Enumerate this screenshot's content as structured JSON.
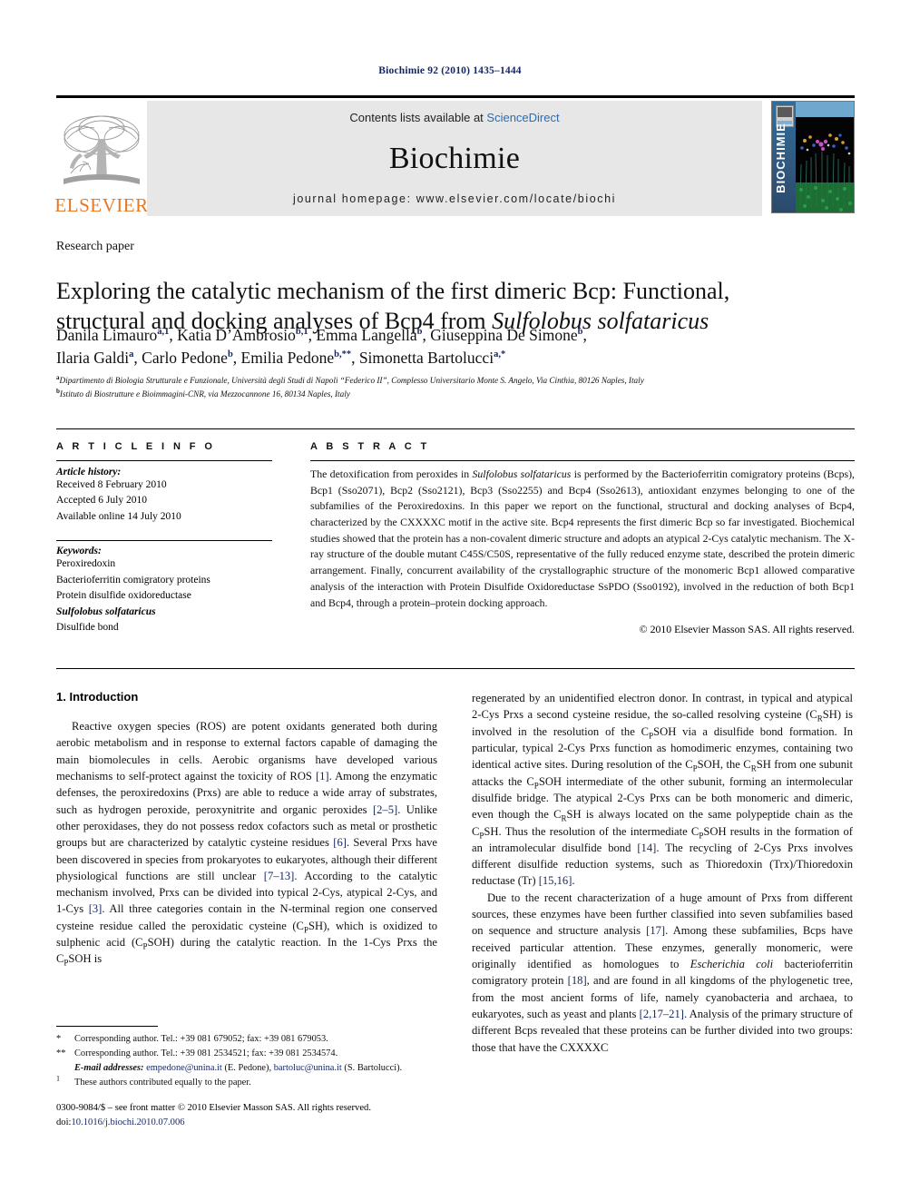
{
  "running_head": "Biochimie 92 (2010) 1435–1444",
  "masthead": {
    "contents_prefix": "Contents lists available at ",
    "contents_link": "ScienceDirect",
    "journal_title": "Biochimie",
    "homepage": "journal homepage: www.elsevier.com/locate/biochi",
    "publisher_logo_text": "ELSEVIER",
    "cover_title": "BIOCHIMIE"
  },
  "article_type": "Research paper",
  "title": {
    "line1": "Exploring the catalytic mechanism of the first dimeric Bcp: Functional,",
    "line2_pre": "structural and docking analyses of Bcp4 from ",
    "line2_italic": "Sulfolobus solfataricus"
  },
  "authors": [
    {
      "name": "Danila Limauro",
      "sup": "a,1",
      "sep": ", "
    },
    {
      "name": "Katia D’Ambrosio",
      "sup": "b,1",
      "sep": ", "
    },
    {
      "name": "Emma Langella",
      "sup": "b",
      "sep": ", "
    },
    {
      "name": "Giuseppina De Simone",
      "sup": "b",
      "sep": ","
    },
    {
      "name": "Ilaria Galdi",
      "sup": "a",
      "sep": ", "
    },
    {
      "name": "Carlo Pedone",
      "sup": "b",
      "sep": ", "
    },
    {
      "name": "Emilia Pedone",
      "sup": "b,**",
      "sep": ", "
    },
    {
      "name": "Simonetta Bartolucci",
      "sup": "a,*",
      "sep": ""
    }
  ],
  "affiliations": [
    {
      "mark": "a",
      "text": "Dipartimento di Biologia Strutturale e Funzionale, Università degli Studi di Napoli “Federico II”, Complesso Universitario Monte S. Angelo, Via Cinthia, 80126 Naples, Italy"
    },
    {
      "mark": "b",
      "text": "Istituto di Biostrutture e Bioimmagini-CNR, via Mezzocannone 16, 80134 Naples, Italy"
    }
  ],
  "article_info": {
    "heading": "A R T I C L E  I N F O",
    "history_label": "Article history:",
    "history": [
      "Received 8 February 2010",
      "Accepted 6 July 2010",
      "Available online 14 July 2010"
    ],
    "keywords_label": "Keywords:",
    "keywords": [
      {
        "text": "Peroxiredoxin",
        "italic": false
      },
      {
        "text": "Bacterioferritin comigratory proteins",
        "italic": false
      },
      {
        "text": "Protein disulfide oxidoreductase",
        "italic": false
      },
      {
        "text": "Sulfolobus solfataricus",
        "italic": true
      },
      {
        "text": "Disulfide bond",
        "italic": false
      }
    ]
  },
  "abstract": {
    "heading": "A B S T R A C T",
    "p1_a": "The detoxification from peroxides in ",
    "p1_italic": "Sulfolobus solfataricus",
    "p1_b": " is performed by the Bacterioferritin comigratory proteins (Bcps), Bcp1 (Sso2071), Bcp2 (Sso2121), Bcp3 (Sso2255) and Bcp4 (Sso2613), antioxidant enzymes belonging to one of the subfamilies of the Peroxiredoxins. In this paper we report on the functional, structural and docking analyses of Bcp4, characterized by the CXXXXC motif in the active site. Bcp4 represents the first dimeric Bcp so far investigated. Biochemical studies showed that the protein has a non-covalent dimeric structure and adopts an atypical 2-Cys catalytic mechanism. The X-ray structure of the double mutant C45S/C50S, representative of the fully reduced enzyme state, described the protein dimeric arrangement. Finally, concurrent availability of the crystallographic structure of the monomeric Bcp1 allowed comparative analysis of the interaction with Protein Disulfide Oxidoreductase SsPDO (Sso0192), involved in the reduction of both Bcp1 and Bcp4, through a protein–protein docking approach.",
    "copyright": "© 2010 Elsevier Masson SAS. All rights reserved."
  },
  "body": {
    "section_heading": "1. Introduction",
    "left_p1": "Reactive oxygen species (ROS) are potent oxidants generated both during aerobic metabolism and in response to external factors capable of damaging the main biomolecules in cells. Aerobic organisms have developed various mechanisms to self-protect against the toxicity of ROS [1]. Among the enzymatic defenses, the peroxiredoxins (Prxs) are able to reduce a wide array of substrates, such as hydrogen peroxide, peroxynitrite and organic peroxides [2–5]. Unlike other peroxidases, they do not possess redox cofactors such as metal or prosthetic groups but are characterized by catalytic cysteine residues [6]. Several Prxs have been discovered in species from prokaryotes to eukaryotes, although their different physiological functions are still unclear [7–13]. According to the catalytic mechanism involved, Prxs can be divided into typical 2-Cys, atypical 2-Cys, and 1-Cys [3]. All three categories contain in the N-terminal region one conserved cysteine residue called the peroxidatic cysteine (CPSH), which is oxidized to sulphenic acid (CPSOH) during the catalytic reaction. In the 1-Cys Prxs the CPSOH is",
    "right_p1": "regenerated by an unidentified electron donor. In contrast, in typical and atypical 2-Cys Prxs a second cysteine residue, the so-called resolving cysteine (CRSH) is involved in the resolution of the CPSOH via a disulfide bond formation. In particular, typical 2-Cys Prxs function as homodimeric enzymes, containing two identical active sites. During resolution of the CPSOH, the CRSH from one subunit attacks the CPSOH intermediate of the other subunit, forming an intermolecular disulfide bridge. The atypical 2-Cys Prxs can be both monomeric and dimeric, even though the CRSH is always located on the same polypeptide chain as the CPSH. Thus the resolution of the intermediate CPSOH results in the formation of an intramolecular disulfide bond [14]. The recycling of 2-Cys Prxs involves different disulfide reduction systems, such as Thioredoxin (Trx)/Thioredoxin reductase (Tr) [15,16].",
    "right_p2": "Due to the recent characterization of a huge amount of Prxs from different sources, these enzymes have been further classified into seven subfamilies based on sequence and structure analysis [17]. Among these subfamilies, Bcps have received particular attention. These enzymes, generally monomeric, were originally identified as homologues to Escherichia coli bacterioferritin comigratory protein [18], and are found in all kingdoms of the phylogenetic tree, from the most ancient forms of life, namely cyanobacteria and archaea, to eukaryotes, such as yeast and plants [2,17–21]. Analysis of the primary structure of different Bcps revealed that these proteins can be further divided into two groups: those that have the CXXXXC"
  },
  "footnotes": {
    "corr1_mark": "*",
    "corr1_text": "Corresponding author. Tel.: +39 081 679052; fax: +39 081 679053.",
    "corr2_mark": "**",
    "corr2_text": "Corresponding author. Tel.: +39 081 2534521; fax: +39 081 2534574.",
    "email_label": "E-mail addresses:",
    "email1": "empedone@unina.it",
    "email1_person": "(E. Pedone),",
    "email2": "bartoluc@unina.it",
    "email2_person": "(S. Bartolucci).",
    "equal_mark": "1",
    "equal_text": "These authors contributed equally to the paper."
  },
  "imprint": {
    "line1": "0300-9084/$ – see front matter © 2010 Elsevier Masson SAS. All rights reserved.",
    "doi_label": "doi:",
    "doi": "10.1016/j.biochi.2010.07.006"
  },
  "colors": {
    "elsevier_orange": "#E87722",
    "link_blue": "#2b6cb0",
    "ref_navy": "#14245f",
    "masthead_gray": "#e7e7e7"
  }
}
